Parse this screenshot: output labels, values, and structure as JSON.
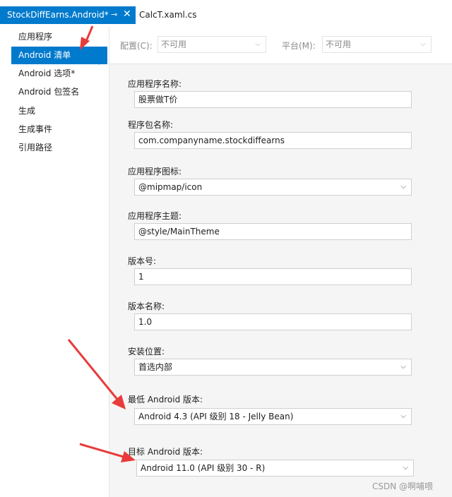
{
  "tabs": [
    {
      "label": "StockDiffEarns.Android*",
      "pin_glyph": "⊸",
      "close_glyph": "✕",
      "active": true
    },
    {
      "label": "CalcT.xaml.cs",
      "active": false
    }
  ],
  "sidebar": {
    "items": [
      {
        "label": "应用程序"
      },
      {
        "label": "Android 清单"
      },
      {
        "label": "Android 选项*"
      },
      {
        "label": "Android 包签名"
      },
      {
        "label": "生成"
      },
      {
        "label": "生成事件"
      },
      {
        "label": "引用路径"
      }
    ],
    "active_index": 1
  },
  "topbar": {
    "config_label": "配置(C):",
    "config_value": "不可用",
    "platform_label": "平台(M):",
    "platform_value": "不可用"
  },
  "fields": {
    "app_name": {
      "label": "应用程序名称:",
      "value": "股票做T价"
    },
    "package_name": {
      "label": "程序包名称:",
      "value": "com.companyname.stockdiffearns"
    },
    "app_icon": {
      "label": "应用程序图标:",
      "value": "@mipmap/icon"
    },
    "app_theme": {
      "label": "应用程序主题:",
      "value": "@style/MainTheme"
    },
    "version_number": {
      "label": "版本号:",
      "value": "1"
    },
    "version_name": {
      "label": "版本名称:",
      "value": "1.0"
    },
    "install_location": {
      "label": "安装位置:",
      "value": "首选内部"
    },
    "min_android": {
      "label": "最低 Android 版本:",
      "value": "Android 4.3 (API 级别 18 - Jelly Bean)"
    },
    "target_android": {
      "label": "目标 Android 版本:",
      "value": "Android 11.0 (API 级别 30 - R)"
    }
  },
  "icons": {
    "dropdown": "chevron-down-icon",
    "annotation": "red-arrow-icon"
  },
  "colors": {
    "accent": "#007acc",
    "annotation": "#e83b3b"
  },
  "watermark": "CSDN @啊哺喂"
}
